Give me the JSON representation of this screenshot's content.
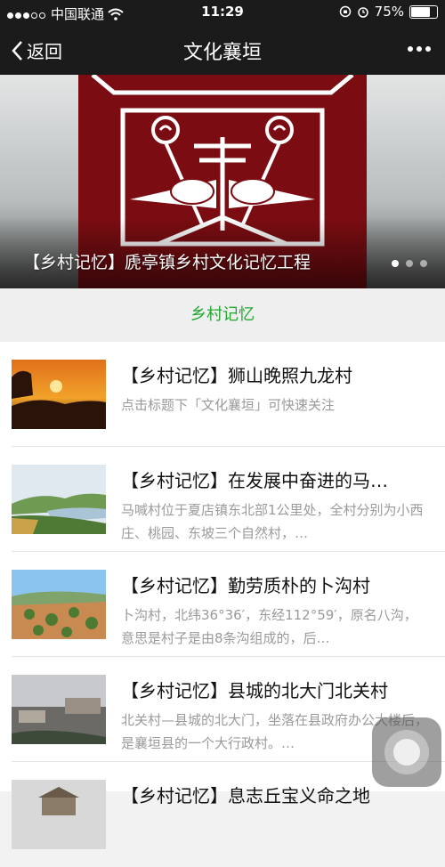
{
  "status_bar": {
    "carrier": "中国联通",
    "time": "11:29",
    "battery": "75%",
    "battery_level": 0.75
  },
  "nav": {
    "back_label": "返回",
    "title": "文化襄垣"
  },
  "banner": {
    "caption": "【乡村记忆】虒亭镇乡村文化记忆工程",
    "active_index": 0
  },
  "section": {
    "title": "乡村记忆"
  },
  "articles": [
    {
      "title": "【乡村记忆】狮山晚照九龙村",
      "desc": "点击标题下「文化襄垣」可快速关注"
    },
    {
      "title": "【乡村记忆】在发展中奋进的马…",
      "desc": "马喊村位于夏店镇东北部1公里处，全村分别为小西庄、桃园、东坡三个自然村，…"
    },
    {
      "title": "【乡村记忆】勤劳质朴的卜沟村",
      "desc": "卜沟村，北纬36°36′，东经112°59′，原名八沟，意思是村子是由8条沟组成的，后…"
    },
    {
      "title": "【乡村记忆】县城的北大门北关村",
      "desc": "北关村—县城的北大门，坐落在县政府办公大楼后，是襄垣县的一个大行政村。…"
    },
    {
      "title": "【乡村记忆】息志丘宝义命之地",
      "desc": ""
    }
  ]
}
